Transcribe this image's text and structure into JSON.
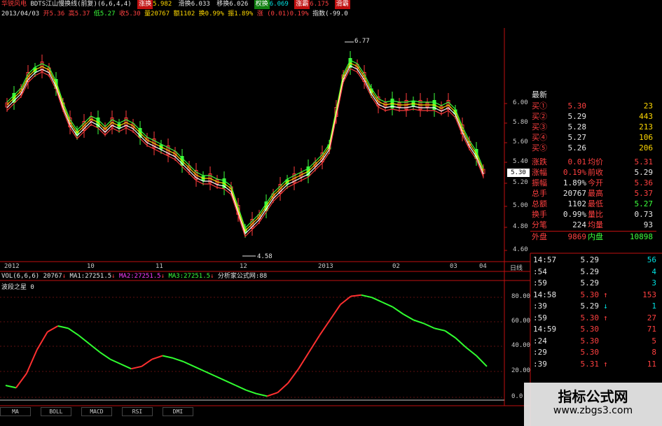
{
  "header": {
    "stock_name": "华锐风电",
    "indicator": "BDTS江山慢换线(前复)(6,6,4,4)",
    "hl1_label": "涨换",
    "hl1_value": "5.982",
    "hl2_label": "滑换",
    "hl2_value": "6.033",
    "hl3_label": "移换",
    "hl3_value": "6.026",
    "hl4_label": "权换",
    "hl4_value": "6.069",
    "hl5_label": "涨霸",
    "hl5_value": "6.175",
    "hl6_label": "滑霸",
    "date": "2013/04/03",
    "open": "开5.36",
    "high": "高5.37",
    "low": "低5.27",
    "close": "收5.30",
    "vol": "量20767",
    "amount": "额1102",
    "turnover": "换0.99%",
    "amplitude": "振1.89%",
    "change": "涨 (0.01)0.19%",
    "index": "指数(-99.0"
  },
  "price_axis": [
    "6.00",
    "5.80",
    "5.60",
    "5.40",
    "5.20",
    "5.00",
    "4.80",
    "4.60"
  ],
  "price_current": "5.30",
  "annotations": {
    "high": "6.77",
    "low": "4.58"
  },
  "time_axis": [
    "2012",
    "10",
    "11",
    "12",
    "2013",
    "02",
    "03",
    "04"
  ],
  "period_label": "日线",
  "vol_header": {
    "name": "VOL(6,6,6)",
    "value": "20767",
    "ma1": "MA1:27251.5",
    "ma2": "MA2:27251.5",
    "ma3": "MA3:27251.5",
    "source": "分析家公式网:88"
  },
  "osc_title": "波段之星 0",
  "osc_axis": [
    "80.00",
    "60.00",
    "40.00",
    "20.00",
    "0.0"
  ],
  "tabs": [
    "MA",
    "BOLL",
    "MACD",
    "RSI",
    "DMI"
  ],
  "quote": {
    "latest_label": "最新",
    "bids": [
      {
        "label": "买①",
        "price": "5.30",
        "vol": "23"
      },
      {
        "label": "买②",
        "price": "5.29",
        "vol": "443"
      },
      {
        "label": "买③",
        "price": "5.28",
        "vol": "213"
      },
      {
        "label": "买④",
        "price": "5.27",
        "vol": "106"
      },
      {
        "label": "买⑤",
        "price": "5.26",
        "vol": "206"
      }
    ],
    "stats": [
      {
        "l1": "涨跌",
        "v1": "0.01",
        "l2": "均价",
        "v2": "5.31"
      },
      {
        "l1": "涨幅",
        "v1": "0.19%",
        "l2": "前收",
        "v2": "5.29"
      },
      {
        "l1": "振幅",
        "v1": "1.89%",
        "l2": "今开",
        "v2": "5.36"
      },
      {
        "l1": "总手",
        "v1": "20767",
        "l2": "最高",
        "v2": "5.37"
      },
      {
        "l1": "总额",
        "v1": "1102",
        "l2": "最低",
        "v2": "5.27"
      },
      {
        "l1": "换手",
        "v1": "0.99%",
        "l2": "量比",
        "v2": "0.73"
      },
      {
        "l1": "分笔",
        "v1": "224",
        "l2": "均量",
        "v2": "93"
      }
    ],
    "outer_label": "外盘",
    "outer_value": "9869",
    "inner_label": "内盘",
    "inner_value": "10898"
  },
  "ticks": [
    {
      "time": "14:57",
      "price": "5.29",
      "arrow": "",
      "vol": "56"
    },
    {
      "time": ":54",
      "price": "5.29",
      "arrow": "",
      "vol": "4"
    },
    {
      "time": ":59",
      "price": "5.29",
      "arrow": "",
      "vol": "3"
    },
    {
      "time": "14:58",
      "price": "5.30",
      "arrow": "↑",
      "vol": "153"
    },
    {
      "time": ":39",
      "price": "5.29",
      "arrow": "↓",
      "vol": "1"
    },
    {
      "time": ":59",
      "price": "5.30",
      "arrow": "↑",
      "vol": "27"
    },
    {
      "time": "14:59",
      "price": "5.30",
      "arrow": "",
      "vol": "71"
    },
    {
      "time": ":24",
      "price": "5.30",
      "arrow": "",
      "vol": "5"
    },
    {
      "time": ":29",
      "price": "5.30",
      "arrow": "",
      "vol": "8"
    },
    {
      "time": ":39",
      "price": "5.31",
      "arrow": "↑",
      "vol": "11"
    }
  ],
  "watermark": {
    "title": "指标公式网",
    "url": "www.zbgs3.com"
  },
  "colors": {
    "up": "#ff3c3c",
    "down": "#3cff3c",
    "frame": "#c01010",
    "accent": "#ffd800"
  },
  "chart_data": [
    {
      "type": "candlestick",
      "title": "华锐风电 日线",
      "x_labels": [
        "2012",
        "10",
        "11",
        "12",
        "2013",
        "02",
        "03",
        "04"
      ],
      "ylim": [
        4.58,
        6.77
      ],
      "annotations": [
        {
          "label": "6.77",
          "kind": "high"
        },
        {
          "label": "4.58",
          "kind": "low"
        }
      ],
      "last_close": 5.3
    },
    {
      "type": "line",
      "title": "波段之星",
      "ylim": [
        0,
        90
      ],
      "series": [
        {
          "color": "mixed",
          "values": [
            10,
            8,
            20,
            40,
            55,
            60,
            58,
            52,
            45,
            38,
            32,
            28,
            24,
            26,
            32,
            35,
            33,
            30,
            26,
            22,
            18,
            14,
            10,
            6,
            3,
            1,
            4,
            12,
            24,
            38,
            52,
            65,
            78,
            85,
            86,
            84,
            80,
            76,
            70,
            65,
            62,
            58,
            56,
            50,
            42,
            35,
            26
          ]
        }
      ]
    }
  ]
}
